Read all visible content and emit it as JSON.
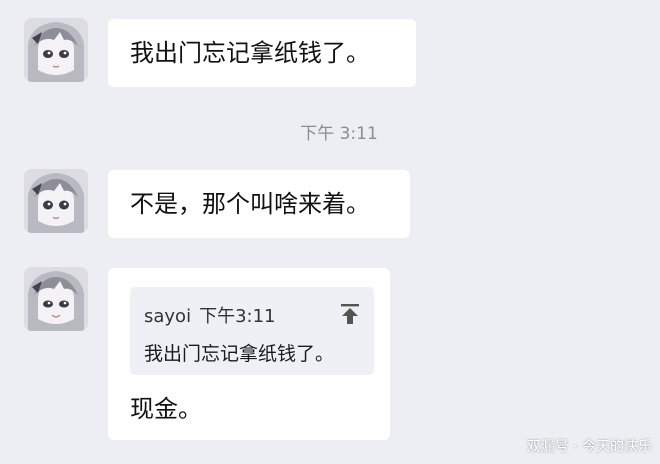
{
  "messages": [
    {
      "sender_avatar": "anime-girl-avatar",
      "text": "我出门忘记拿纸钱了。"
    },
    {
      "sender_avatar": "anime-girl-avatar",
      "text": "不是，那个叫啥来着。"
    },
    {
      "sender_avatar": "anime-girl-avatar",
      "quote": {
        "author": "sayoi",
        "time": "下午3:11",
        "text": "我出门忘记拿纸钱了。",
        "icon": "jump-to-message-icon"
      },
      "text": "现金。"
    }
  ],
  "timestamp": "下午 3:11",
  "watermark": "双漏号 · 今天的快乐",
  "colors": {
    "background": "#edeef3",
    "bubble": "#ffffff",
    "quote_bg": "#eef0f5",
    "timestamp": "#8c8c94"
  }
}
